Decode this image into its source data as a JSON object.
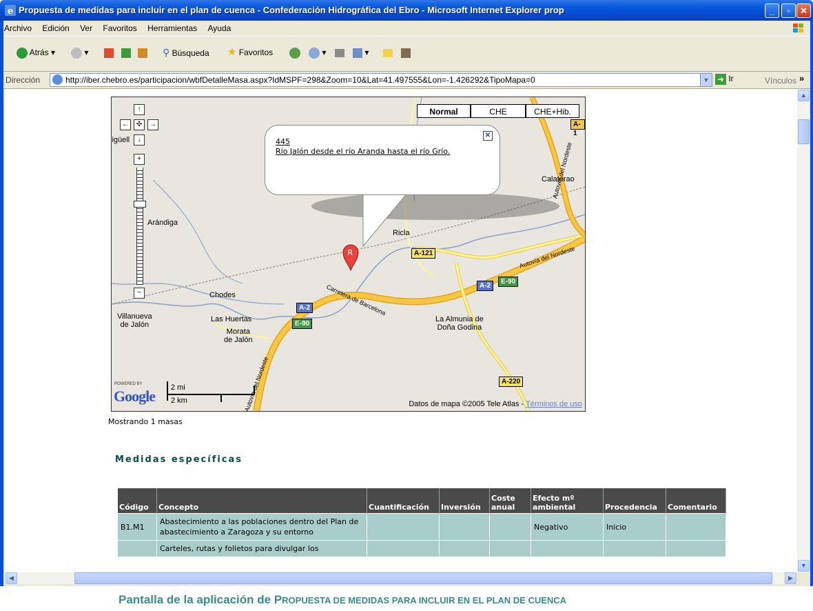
{
  "window": {
    "title": "Propuesta de medidas para incluir en el plan de cuenca - Confederación Hidrográfica del Ebro - Microsoft Internet Explorer prop"
  },
  "menu": [
    "Archivo",
    "Edición",
    "Ver",
    "Favoritos",
    "Herramientas",
    "Ayuda"
  ],
  "toolbar": {
    "back": "Atrás",
    "search": "Búsqueda",
    "favorites": "Favoritos"
  },
  "address": {
    "label": "Dirección",
    "url": "http://iber.chebro.es/participacion/wbfDetalleMasa.aspx?IdMSPF=298&Zoom=10&Lat=41.497555&Lon=-1.426292&TipoMapa=0",
    "go": "Ir",
    "links": "Vínculos"
  },
  "map": {
    "types": [
      "Normal",
      "CHE",
      "CHE+Hib."
    ],
    "popup": {
      "id": "445",
      "name": "Río Jalón desde el río Aranda hasta el río Grío."
    },
    "marker": "R",
    "places": {
      "miguel": "iigüell",
      "calatorao": "Calatorao",
      "arandiga": "Arándiga",
      "ricla": "Ricla",
      "chodes": "Chodes",
      "villanueva": "Villanueva\nde Jalón",
      "huertas": "Las Huertas",
      "morata": "Morata\nde Jalón",
      "almunia": "La Almunia de\nDoña Godina",
      "carretera": "Carretera de Barcelona",
      "autovia1": "Autovía del Nordeste",
      "autovia2": "Autovía del Nordeste",
      "autovia3": "Autovía del Nordeste"
    },
    "roads": {
      "a1": "A-1",
      "a121": "A-121",
      "a2a": "A-2",
      "e90a": "E-90",
      "a2b": "A-2",
      "e90b": "E-90",
      "a220": "A-220"
    },
    "powered": "POWERED BY",
    "google": "Google",
    "scale_mi": "2 mi",
    "scale_km": "2 km",
    "copyright": "Datos de mapa ©2005 Tele Atlas - ",
    "terms": "Términos de uso"
  },
  "showing": "Mostrando 1 masas",
  "section_title": "Medidas específicas",
  "table": {
    "headers": [
      "Código",
      "Concepto",
      "Cuantificación",
      "Inversión",
      "Coste anual",
      "Efecto mº ambiental",
      "Procedencia",
      "Comentario"
    ],
    "rows": [
      [
        "B1.M1",
        "Abastecimiento a las poblaciones dentro del Plan de abastecimiento a Zaragoza y su entorno",
        "",
        "",
        "",
        "Negativo",
        "Inicio",
        ""
      ],
      [
        "",
        "Carteles, rutas y folletos para divulgar los",
        "",
        "",
        "",
        "",
        "",
        ""
      ]
    ]
  },
  "caption": {
    "lead": "Pantalla de la aplicación de P",
    "rest": "ROPUESTA DE MEDIDAS PARA INCLUIR EN EL PLAN DE CUENCA"
  }
}
